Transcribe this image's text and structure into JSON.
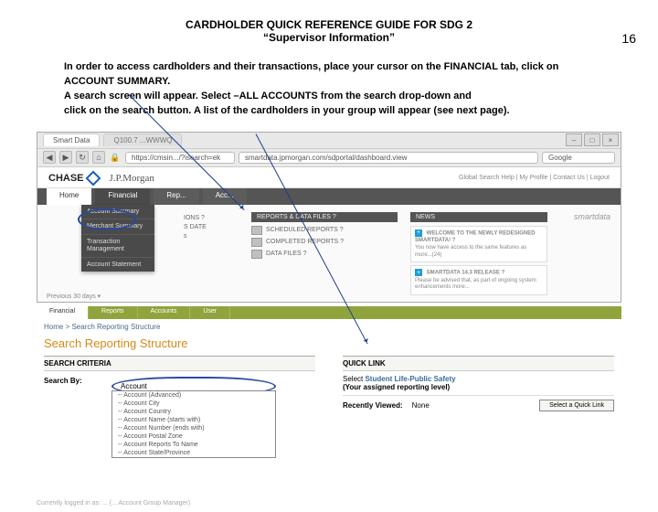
{
  "page_number": "16",
  "title": "CARDHOLDER QUICK REFERENCE GUIDE FOR SDG 2",
  "subtitle": "“Supervisor Information”",
  "instructions": {
    "l1": "In order to access cardholders and their transactions, place your cursor on the FINANCIAL tab, click on",
    "l2": "ACCOUNT SUMMARY.",
    "l3": "A search screen will appear. Select –ALL ACCOUNTS from the search drop-down and",
    "l4": "click on the search button. A list of the cardholders in your group will appear (see next page)."
  },
  "browser1": {
    "tab_active": "Smart Data",
    "tab_inactive": "Q100.7 ...WWWQ",
    "url": "smartdata.jpmorgan.com/sdportal/dashboard.view",
    "lock_url_left": "https://cmsin.../?isearch=ek",
    "search_engine": "Google",
    "win_min": "–",
    "win_max": "□",
    "win_close": "×",
    "nav_back": "◀",
    "nav_fwd": "▶",
    "nav_reload": "↻",
    "nav_home": "⌂",
    "logo_chase": "CHASE",
    "logo_jpm": "J.P.Morgan",
    "toplinks": "Global Search  Help | My Profile | Contact Us | Logout",
    "brand_right": "smartdata",
    "tabs": {
      "home": "Home",
      "financial": "Financial",
      "reports": "Rep...",
      "accounts": "Acc..."
    },
    "dropdown": {
      "account_summary": "Account Summary",
      "merchant_summary": "Merchant Summary",
      "transaction_mgmt": "Transaction Management",
      "account_stmt": "Account Statement"
    },
    "left_hints": {
      "ions": "IONS ?",
      "date": "S DATE",
      "s": "s"
    },
    "reports_hd": "REPORTS & DATA FILES ?",
    "reports": {
      "scheduled": "SCHEDULED REPORTS ?",
      "completed": "COMPLETED REPORTS ?",
      "datafiles": "DATA FILES ?"
    },
    "news_hd": "NEWS",
    "news1_title": "WELCOME TO THE NEWLY REDESIGNED SMARTDATA! ?",
    "news1_body": "You now have access to the same features as more...(24)",
    "news2_title": "SMARTDATA 14.3 RELEASE ?",
    "news2_body": "Please be advised that, as part of ongoing system enhancements more...",
    "plus": "+",
    "prev30": "Previous 30 days ▾"
  },
  "browser2": {
    "tabs": {
      "financial": "Financial",
      "reports": "Reports",
      "accounts": "Accounts",
      "user": "User"
    },
    "crumb": "Home > Search Reporting Structure",
    "title": "Search Reporting Structure",
    "search_criteria_hd": "SEARCH CRITERIA",
    "search_by": "Search By:",
    "dd_top": "Account",
    "options": [
      "-- Account (Advanced)",
      "-- Account City",
      "-- Account Country",
      "-- Account Name (starts with)",
      "-- Account Number (ends with)",
      "-- Account Postal Zone",
      "-- Account Reports To Name",
      "-- Account State/Province"
    ],
    "quicklink_hd": "QUICK LINK",
    "ql_select": "Select ",
    "ql_bold": "Student Life-Public Safety",
    "ql_sub": "(Your assigned reporting level)",
    "recent_label": "Recently Viewed:",
    "recent_val": "None",
    "select_btn": "Select a Quick Link"
  },
  "footer": "Currently logged in as: ... (... Account Group Manager)"
}
